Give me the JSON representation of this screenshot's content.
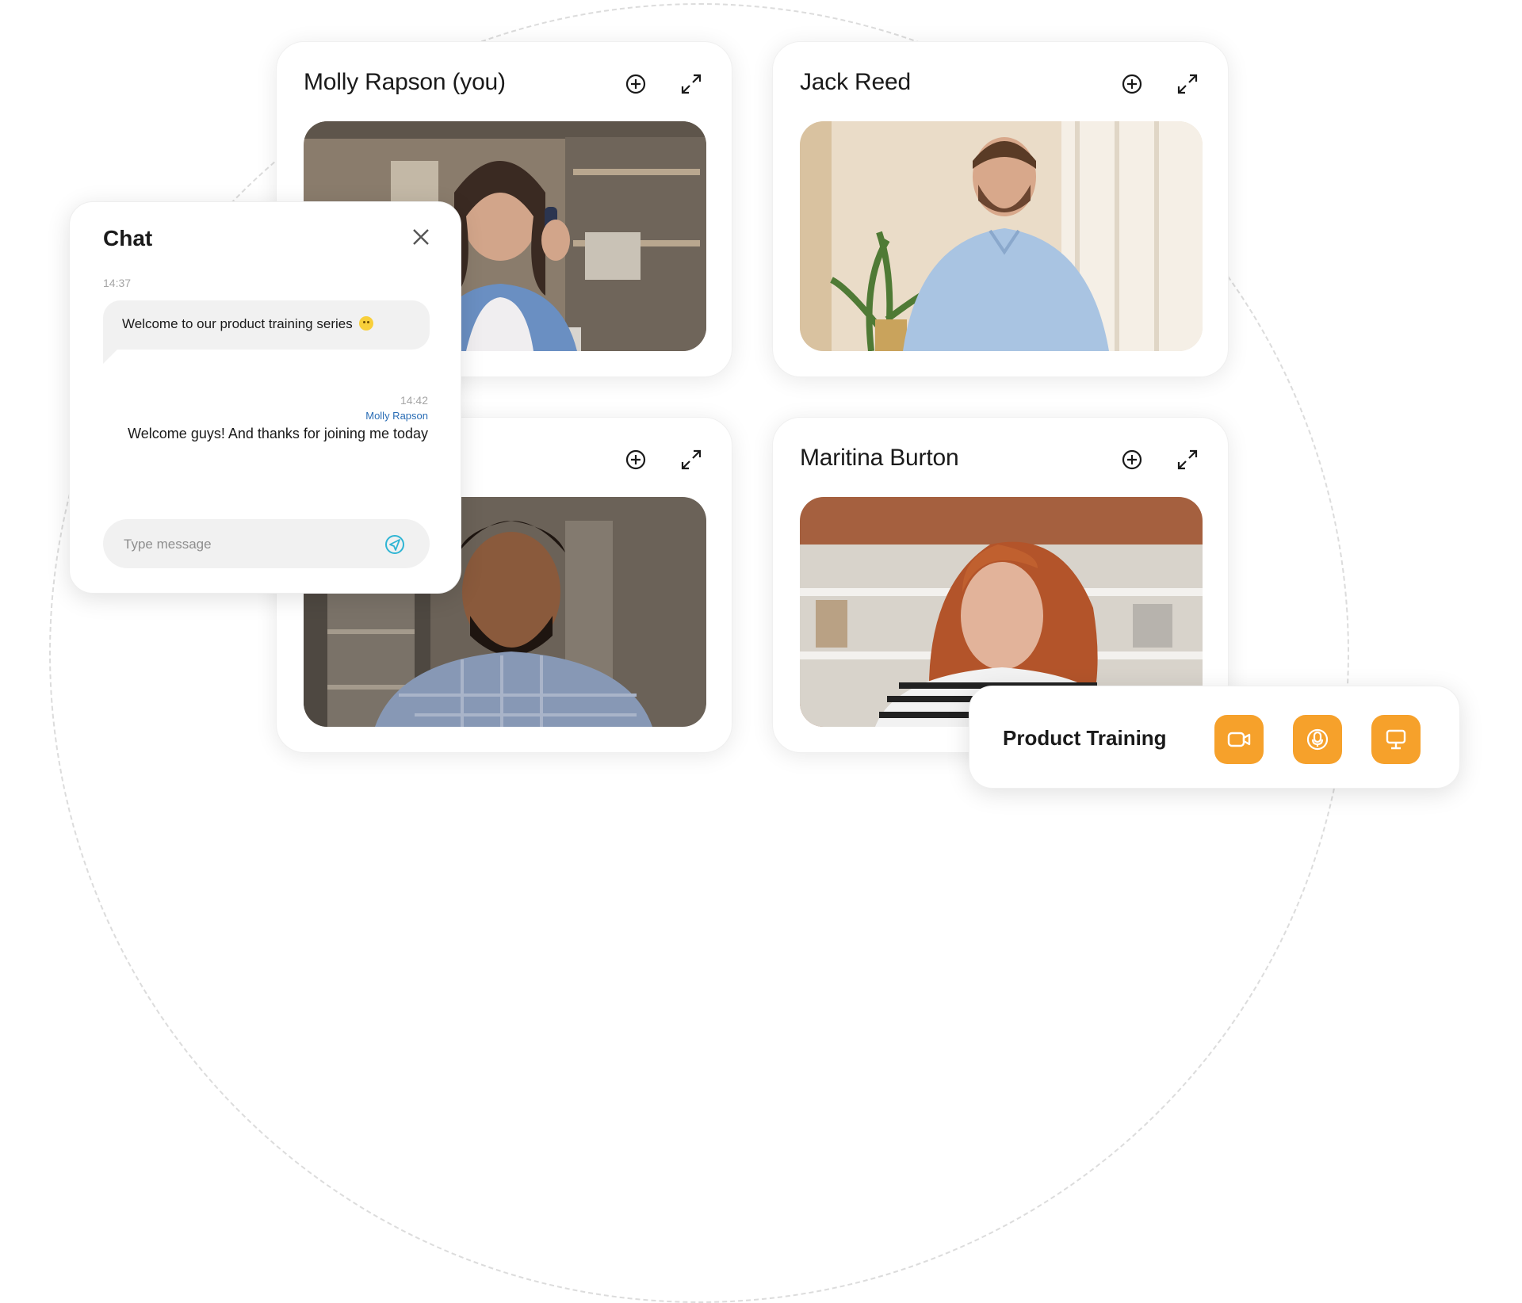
{
  "participants": [
    {
      "name": "Molly Rapson (you)"
    },
    {
      "name": "Jack Reed"
    },
    {
      "name": ""
    },
    {
      "name": "Maritina Burton"
    }
  ],
  "chat": {
    "title": "Chat",
    "messages": [
      {
        "time": "14:37",
        "sender": "",
        "text": "Welcome to our product training series"
      },
      {
        "time": "14:42",
        "sender": "Molly Rapson",
        "text": "Welcome guys! And thanks for joining me today"
      }
    ],
    "input_placeholder": "Type message"
  },
  "meeting": {
    "title": "Product Training",
    "controls": [
      "video-camera-icon",
      "microphone-icon",
      "screen-share-icon"
    ]
  },
  "colors": {
    "accent": "#f6a12b",
    "sender_link": "#2a6db5",
    "send_icon": "#2fb5d4"
  }
}
